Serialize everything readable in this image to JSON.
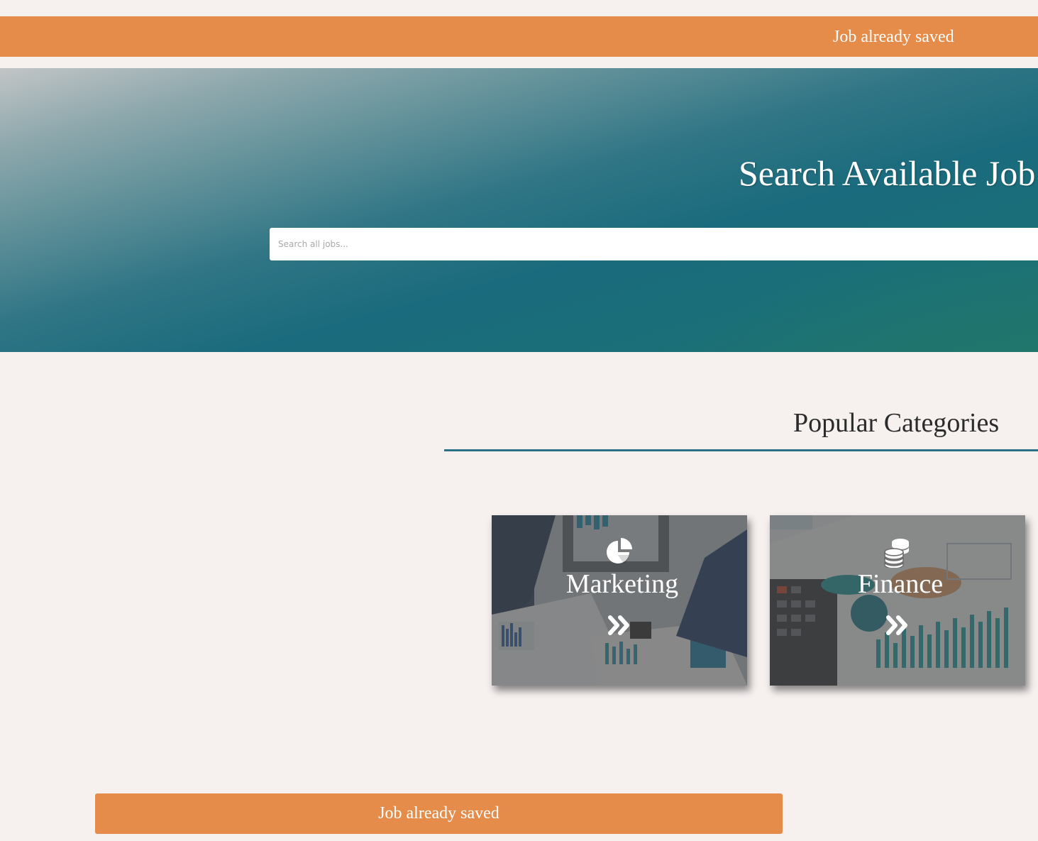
{
  "notifications": {
    "top_message": "Job already saved",
    "bottom_message": "Job already saved"
  },
  "hero": {
    "title": "Search Available Job",
    "search_placeholder": "Search all jobs..."
  },
  "categories": {
    "title": "Popular Categories",
    "items": [
      {
        "label": "Marketing",
        "icon": "pie-chart-icon"
      },
      {
        "label": "Finance",
        "icon": "coins-icon"
      }
    ]
  },
  "colors": {
    "accent_orange": "#e58c4a",
    "teal": "#1a6b7d",
    "rule": "#2d7186",
    "background": "#f6f0ef"
  }
}
